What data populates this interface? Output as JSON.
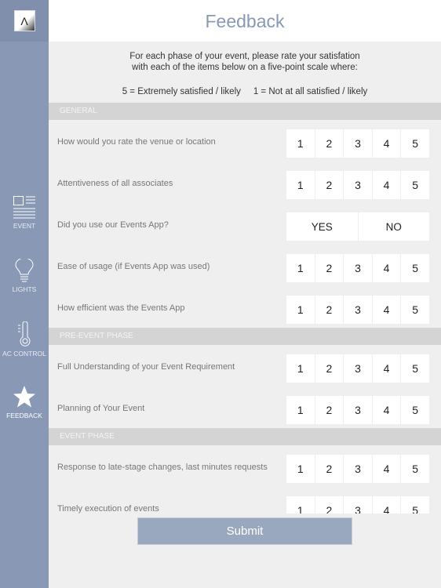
{
  "header": {
    "title": "Feedback"
  },
  "sidebar": {
    "logo": "Λ",
    "items": [
      {
        "label": "EVENT",
        "icon": "newspaper-icon"
      },
      {
        "label": "LIGHTS",
        "icon": "lightbulb-icon"
      },
      {
        "label": "AC CONTROL",
        "icon": "thermometer-icon"
      },
      {
        "label": "FEEDBACK",
        "icon": "star-icon",
        "active": true
      }
    ]
  },
  "intro": {
    "line1": "For each phase of your event, please rate your satisfation",
    "line2": "with each of the items below on a five-point scale where:",
    "scale": "5 = Extremely satisfied / likely     1 = Not at all satisfied / likely"
  },
  "rating_options": [
    "1",
    "2",
    "3",
    "4",
    "5"
  ],
  "yes_no": [
    "YES",
    "NO"
  ],
  "sections": [
    {
      "title": "GENERAL",
      "questions": [
        {
          "text": "How would you rate the venue or location",
          "type": "rating"
        },
        {
          "text": "Attentiveness of all associates",
          "type": "rating"
        },
        {
          "text": "Did you use our Events App?",
          "type": "yesno"
        },
        {
          "text": "Ease of usage (if Events App was used)",
          "type": "rating"
        },
        {
          "text": "How efficient was the Events App",
          "type": "rating"
        }
      ]
    },
    {
      "title": "PRE-EVENT PHASE",
      "questions": [
        {
          "text": "Full Understanding of your Event Requirement",
          "type": "rating"
        },
        {
          "text": "Planning of Your Event",
          "type": "rating"
        }
      ]
    },
    {
      "title": "EVENT PHASE",
      "questions": [
        {
          "text": "Response to late-stage changes, last minutes requests",
          "type": "rating"
        },
        {
          "text": "Timely execution of events",
          "type": "rating"
        }
      ]
    }
  ],
  "submit_label": "Submit",
  "colors": {
    "sidebar": "#8898b5",
    "accent": "#9aa8bf",
    "section": "#d4d4d4"
  }
}
